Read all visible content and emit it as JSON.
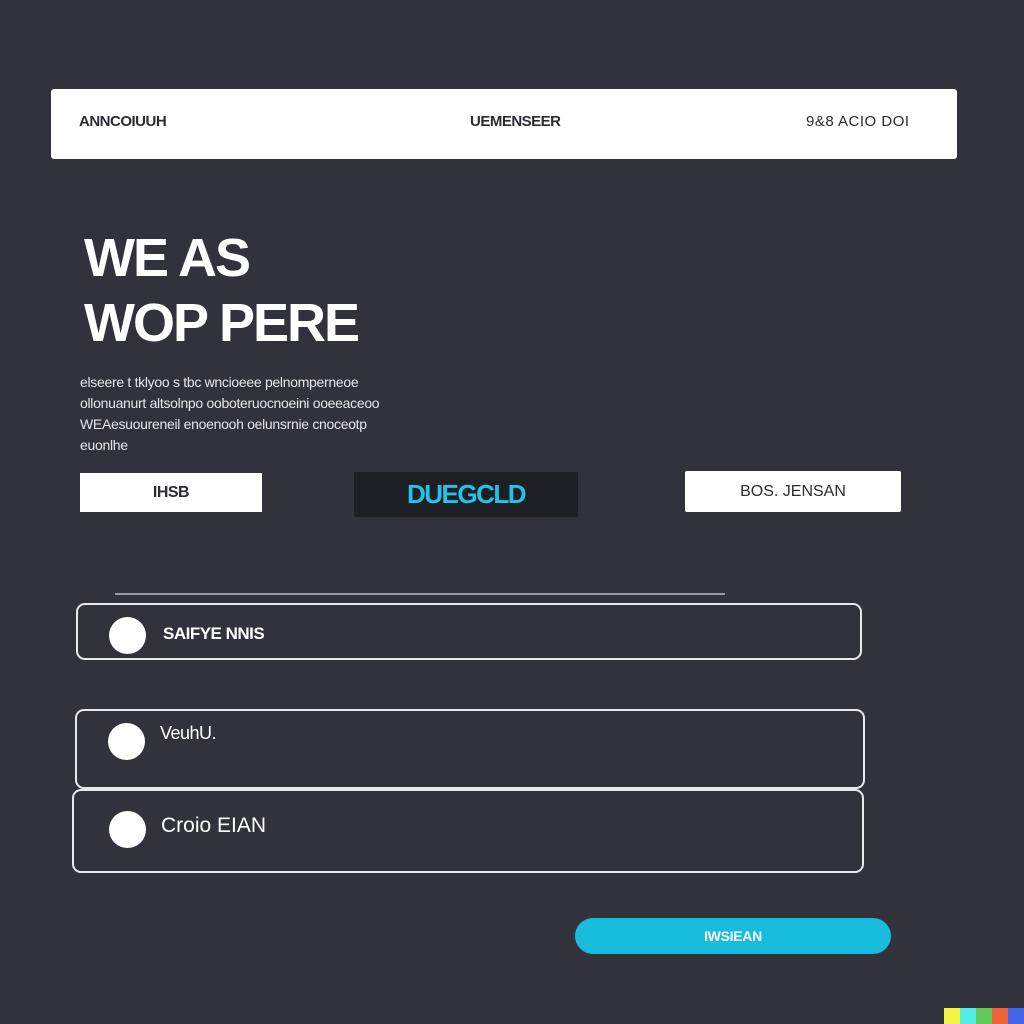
{
  "header": {
    "nav_left": "ANNCOIUUH",
    "nav_center": "UEMENSEER",
    "nav_right": "9&8  ACIO DOI"
  },
  "hero": {
    "line1": "WE AS",
    "line2": "WOP PERE"
  },
  "description": {
    "lines": [
      "elseere  t tklyoo s tbc wncioeee pelnomperneoe",
      "ollonuanurt altsolnpo  ooboteruocnoeini  ooeeaceoo",
      "WEAesuoureneil  enoenooh  oelunsrnie cnoceotp",
      "euonlhe"
    ]
  },
  "buttons": {
    "left_label": "IHSB",
    "middle_label": "DUEGCLD",
    "right_label": "BOS. JENSAN"
  },
  "options": [
    {
      "label": "SAIFYE NNIS"
    },
    {
      "label": "VeuhU."
    },
    {
      "label": "Croio EIAN"
    }
  ],
  "submit": {
    "label": "IWSIEAN"
  },
  "colors": {
    "background": "#31323b",
    "accent": "#18bcdc",
    "accent_text": "#22c3e6",
    "card": "#ffffff",
    "dark_button": "#1e1f24"
  },
  "swatches": [
    "#f5f545",
    "#55ece8",
    "#63c95b",
    "#f0623c",
    "#4565e8"
  ]
}
